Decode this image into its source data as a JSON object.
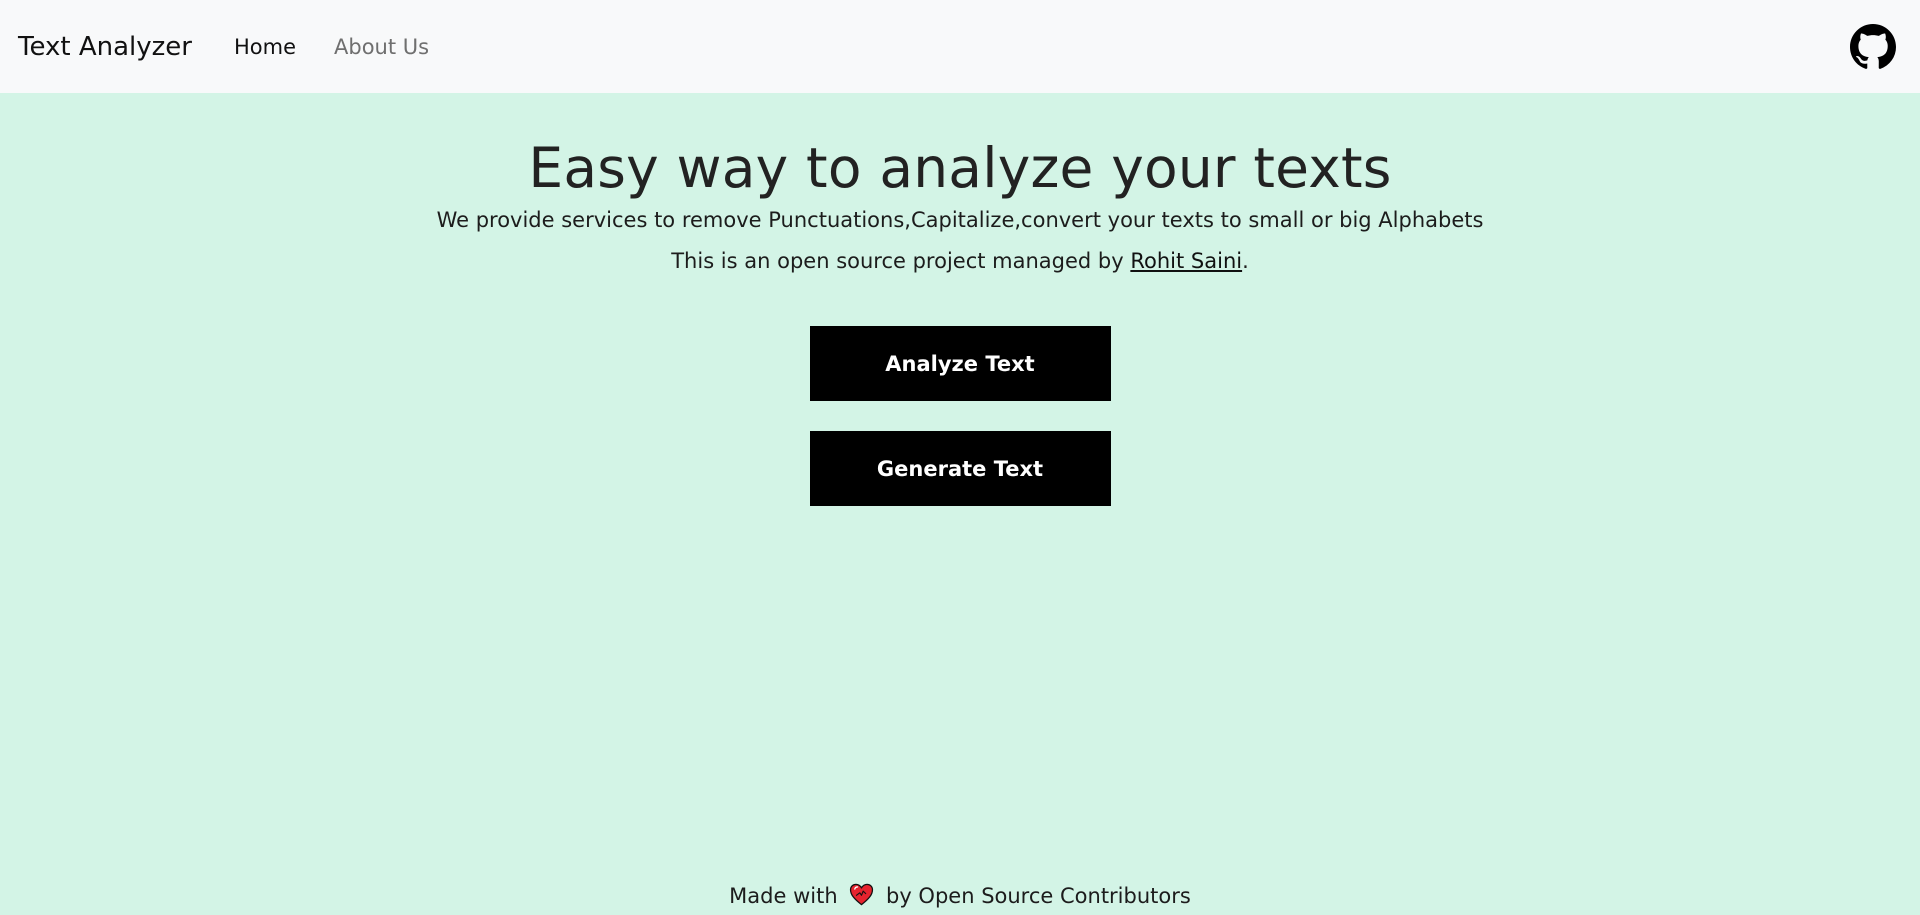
{
  "navbar": {
    "brand": "Text Analyzer",
    "links": [
      {
        "label": "Home",
        "active": true
      },
      {
        "label": "About Us",
        "active": false
      }
    ],
    "github_icon": "github-icon"
  },
  "hero": {
    "title": "Easy way to analyze your texts",
    "subtitle": "We provide services to remove Punctuations,Capitalize,convert your texts to small or big Alphabets",
    "credit_prefix": "This is an open source project managed by ",
    "author": "Rohit Saini",
    "credit_suffix": "."
  },
  "actions": {
    "analyze_label": "Analyze Text",
    "generate_label": "Generate Text"
  },
  "footer": {
    "prefix": "Made with",
    "heart_icon": "heart-icon",
    "suffix": "by Open Source Contributors"
  },
  "colors": {
    "background": "#d3f4e6",
    "navbar": "#f8f9fa",
    "button": "#000000",
    "button_text": "#ffffff",
    "heart": "#e6232e"
  }
}
